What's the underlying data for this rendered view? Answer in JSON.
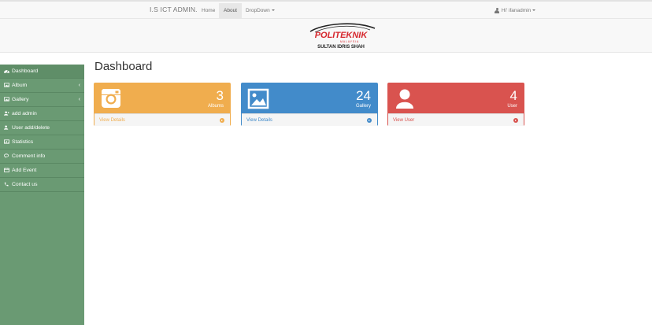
{
  "navbar": {
    "brand": "I.S ICT ADMIN.",
    "items": [
      {
        "label": "Home"
      },
      {
        "label": "About"
      },
      {
        "label": "DropDown"
      }
    ],
    "user_label": "Hi' ifanadmin"
  },
  "logo": {
    "text_main": "POLITEKNIK",
    "text_sub": "MALAYSIA",
    "text_name": "SULTAN IDRIS SHAH"
  },
  "sidebar": {
    "items": [
      {
        "label": "Dashboard",
        "icon": "dashboard-icon"
      },
      {
        "label": "Album",
        "icon": "image-icon"
      },
      {
        "label": "Gallery",
        "icon": "image-icon"
      },
      {
        "label": "add admin",
        "icon": "user-add-icon"
      },
      {
        "label": "User add/delete",
        "icon": "user-icon"
      },
      {
        "label": "Statistics",
        "icon": "chart-icon"
      },
      {
        "label": "Comment info",
        "icon": "comments-icon"
      },
      {
        "label": "Add Event",
        "icon": "calendar-icon"
      },
      {
        "label": "Contact us",
        "icon": "phone-icon"
      }
    ],
    "chevron": "‹"
  },
  "main": {
    "title": "Dashboard",
    "panels": [
      {
        "count": "3",
        "label": "Albums",
        "footer": "View Details",
        "color": "#f0ad4e",
        "icon": "instagram-icon"
      },
      {
        "count": "24",
        "label": "Gallery",
        "footer": "View Details",
        "color": "#428bca",
        "icon": "picture-icon"
      },
      {
        "count": "4",
        "label": "User",
        "footer": "View User",
        "color": "#d9534f",
        "icon": "user-icon"
      }
    ]
  }
}
